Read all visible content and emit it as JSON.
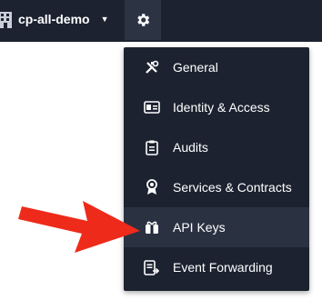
{
  "header": {
    "org_name": "cp-all-demo",
    "org_icon": "building-icon",
    "dropdown_icon": "caret-down-icon",
    "settings_icon": "gear-icon"
  },
  "settings_menu": {
    "items": [
      {
        "label": "General",
        "icon": "tools-icon"
      },
      {
        "label": "Identity & Access",
        "icon": "id-card-icon"
      },
      {
        "label": "Audits",
        "icon": "clipboard-icon"
      },
      {
        "label": "Services & Contracts",
        "icon": "award-icon"
      },
      {
        "label": "API Keys",
        "icon": "key-icon",
        "highlighted": true
      },
      {
        "label": "Event Forwarding",
        "icon": "event-forward-icon"
      }
    ]
  },
  "annotation": {
    "arrow_color": "#ee2a1b",
    "points_to": "API Keys"
  },
  "colors": {
    "topbar": "#1c2230",
    "menu_bg": "#1c2230",
    "menu_hover": "#2a3242",
    "text": "#ffffff"
  }
}
